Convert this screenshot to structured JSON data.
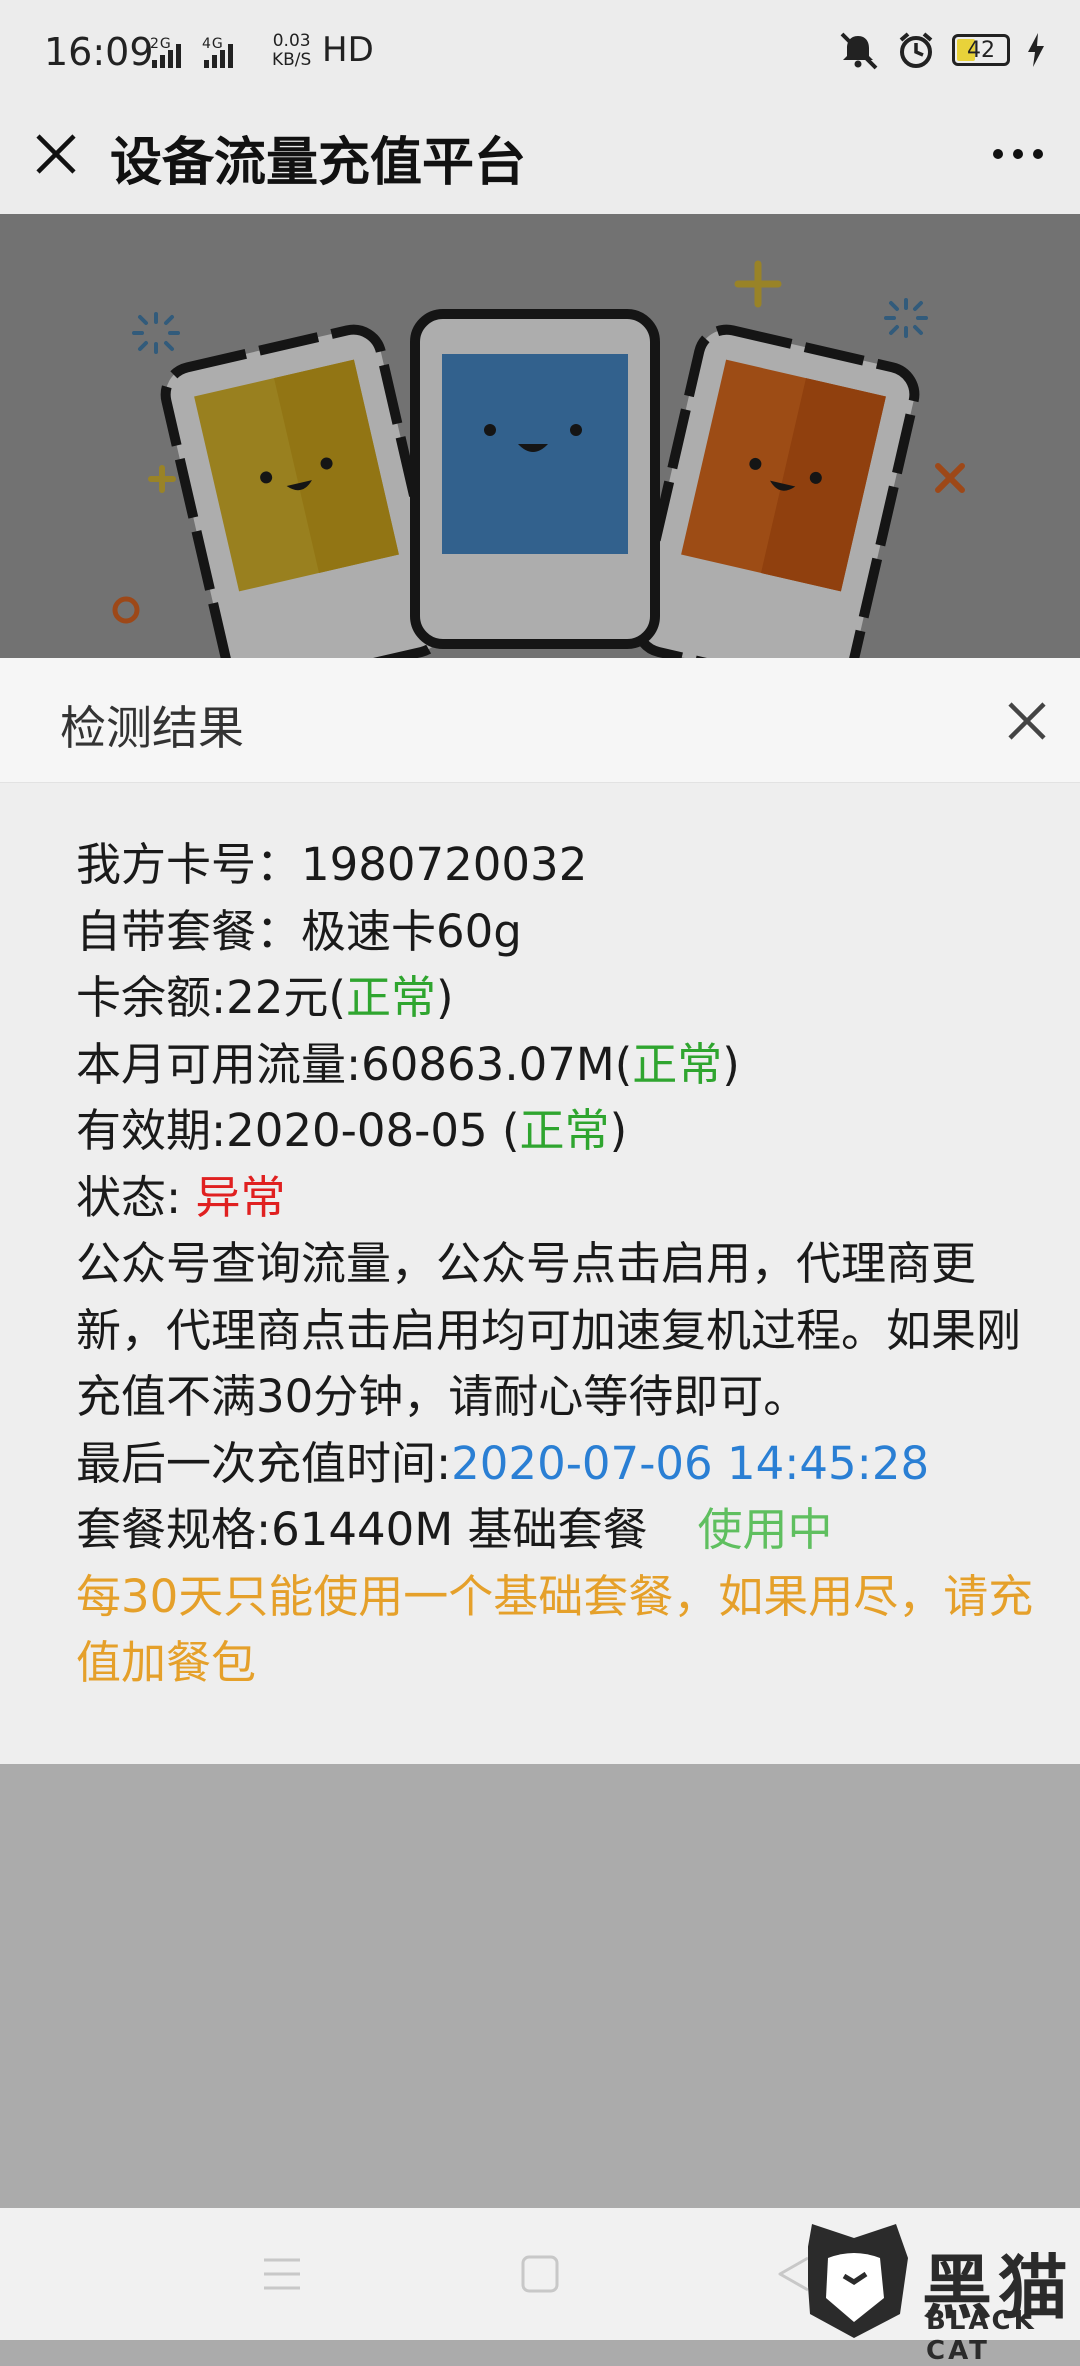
{
  "status_bar": {
    "time": "16:09",
    "network": "2G  4G",
    "speed_value": "0.03",
    "speed_unit": "KB/S",
    "hd": "HD",
    "battery": "42"
  },
  "titlebar": {
    "title": "设备流量充值平台"
  },
  "dialog": {
    "title": "检测结果",
    "card_label": "我方卡号：",
    "card_value": "1980720032",
    "package_label": "自带套餐：",
    "package_value": "极速卡60g",
    "balance_label": "卡余额:22元(",
    "balance_status": "正常",
    "balance_close": ")",
    "traffic_label": "本月可用流量:60863.07M(",
    "traffic_status": "正常",
    "traffic_close": ")",
    "expiry_label": "有效期:2020-08-05 (",
    "expiry_status": "正常",
    "expiry_close": ")",
    "state_label": "状态: ",
    "state_value": "异常",
    "notice": "公众号查询流量，公众号点击启用，代理商更新，代理商点击启用均可加速复机过程。如果刚充值不满30分钟，请耐心等待即可。",
    "last_recharge_label": "最后一次充值时间:",
    "last_recharge_value": "2020-07-06 14:45:28",
    "spec_label": "套餐规格:61440M 基础套餐",
    "spec_status": "使用中",
    "warning": "每30天只能使用一个基础套餐，如果用尽，请充值加餐包"
  },
  "watermark": {
    "text": "黑猫",
    "sub": "BLACK CAT"
  },
  "colors": {
    "normal_green": "#2fa52f",
    "abnormal_red": "#e02020",
    "date_blue": "#2a7fd4",
    "in_use_green": "#5fbf5f",
    "warning_orange": "#e5a02a"
  },
  "icons": [
    "close-icon",
    "more-icon",
    "mute-icon",
    "alarm-icon",
    "battery-icon",
    "charging-icon",
    "menu-nav-icon",
    "home-nav-icon",
    "back-nav-icon"
  ]
}
